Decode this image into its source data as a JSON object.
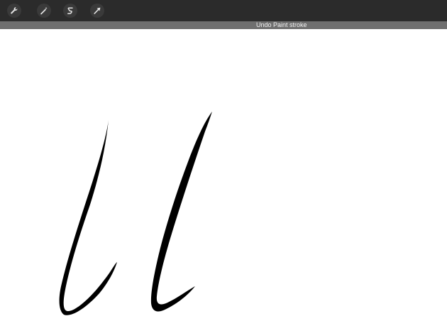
{
  "toolbar": {
    "tools": [
      {
        "icon": "wrench-icon",
        "name": "actions"
      },
      {
        "icon": "magic-wand-icon",
        "name": "adjustments"
      },
      {
        "icon": "selection-s-icon",
        "name": "selection"
      },
      {
        "icon": "arrow-cursor-icon",
        "name": "transform"
      }
    ]
  },
  "notification": {
    "text": "Undo Paint stroke"
  },
  "colors": {
    "toolbar_bg": "#2b2b2b",
    "notification_bg": "#6f6f6f",
    "canvas_bg": "#ffffff",
    "stroke": "#000000"
  }
}
